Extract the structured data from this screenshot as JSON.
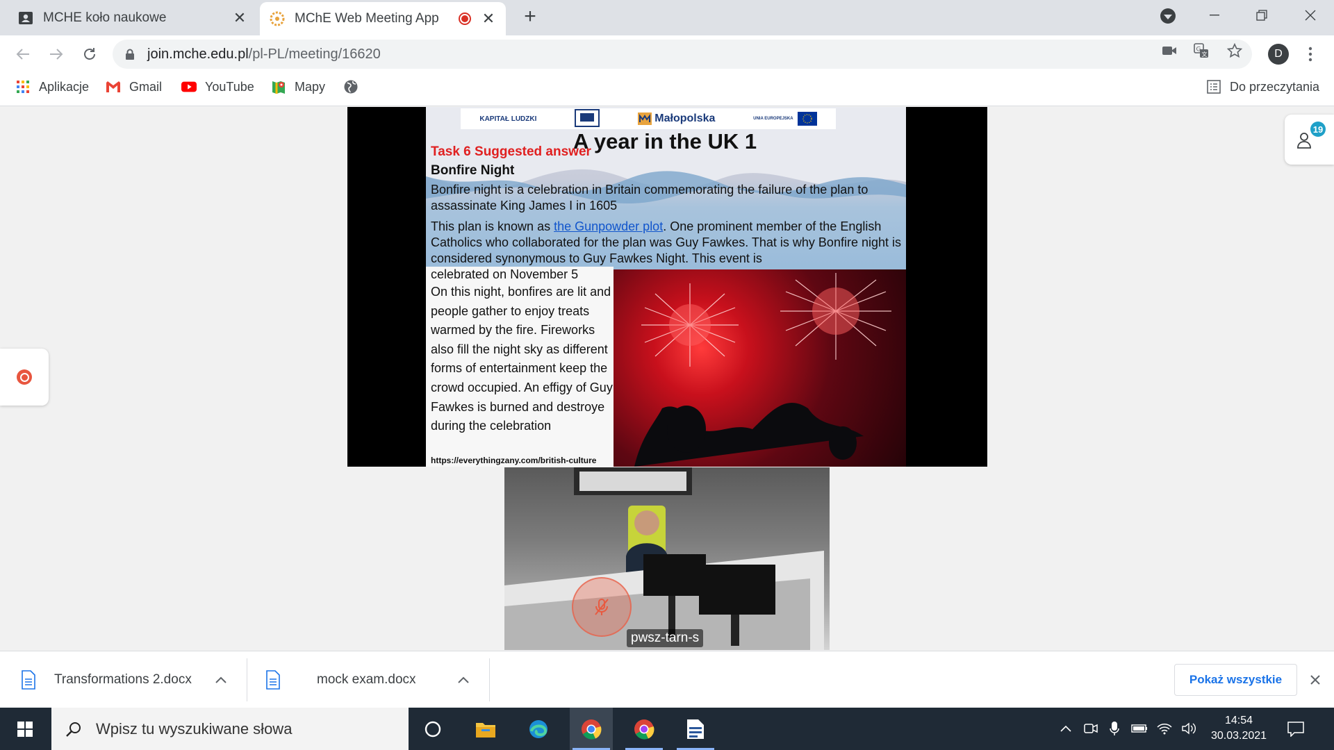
{
  "tabs": [
    {
      "title": "MCHE koło naukowe",
      "active": false
    },
    {
      "title": "MChE Web Meeting App",
      "active": true,
      "recording": true
    }
  ],
  "address": {
    "domain": "join.mche.edu.pl",
    "path": "/pl-PL/meeting/16620"
  },
  "profile_initial": "D",
  "bookmarks": [
    {
      "label": "Aplikacje",
      "icon": "apps-grid-icon"
    },
    {
      "label": "Gmail",
      "icon": "gmail-icon"
    },
    {
      "label": "YouTube",
      "icon": "youtube-icon"
    },
    {
      "label": "Mapy",
      "icon": "maps-icon"
    },
    {
      "label": "",
      "icon": "globe-icon"
    }
  ],
  "reading_list_label": "Do przeczytania",
  "slide": {
    "title": "A year in the UK 1",
    "task": "Task 6 Suggested answer",
    "subtitle": "Bonfire Night",
    "logo_center": "Małopolska",
    "logo_left": "KAPITAŁ LUDZKI",
    "logo_right": "UNIA EUROPEJSKA",
    "p1": "Bonfire night is a celebration in Britain commemorating the failure of the plan to assassinate King James I in 1605",
    "p2_before": "This plan is known as ",
    "p2_link": "the Gunpowder plot",
    "p2_after": ". One prominent member of the English Catholics who collaborated for the plan was Guy Fawkes. That is why Bonfire night is considered synonymous to Guy Fawkes Night. This event is",
    "p3": "celebrated on November 5",
    "left_col": "On this night, bonfires are lit and people gather to enjoy treats warmed by the fire. Fireworks also fill the night sky as different forms of entertainment keep the crowd occupied. An effigy of Guy Fawkes is burned and destroye during the celebration",
    "source": "https://everythingzany.com/british-culture"
  },
  "participant_name": "pwsz-tarn-s",
  "participants_count": "19",
  "downloads": [
    {
      "name": "Transformations 2.docx"
    },
    {
      "name": "mock exam.docx"
    }
  ],
  "show_all_label": "Pokaż wszystkie",
  "taskbar": {
    "search_placeholder": "Wpisz tu wyszukiwane słowa",
    "time": "14:54",
    "date": "30.03.2021"
  }
}
